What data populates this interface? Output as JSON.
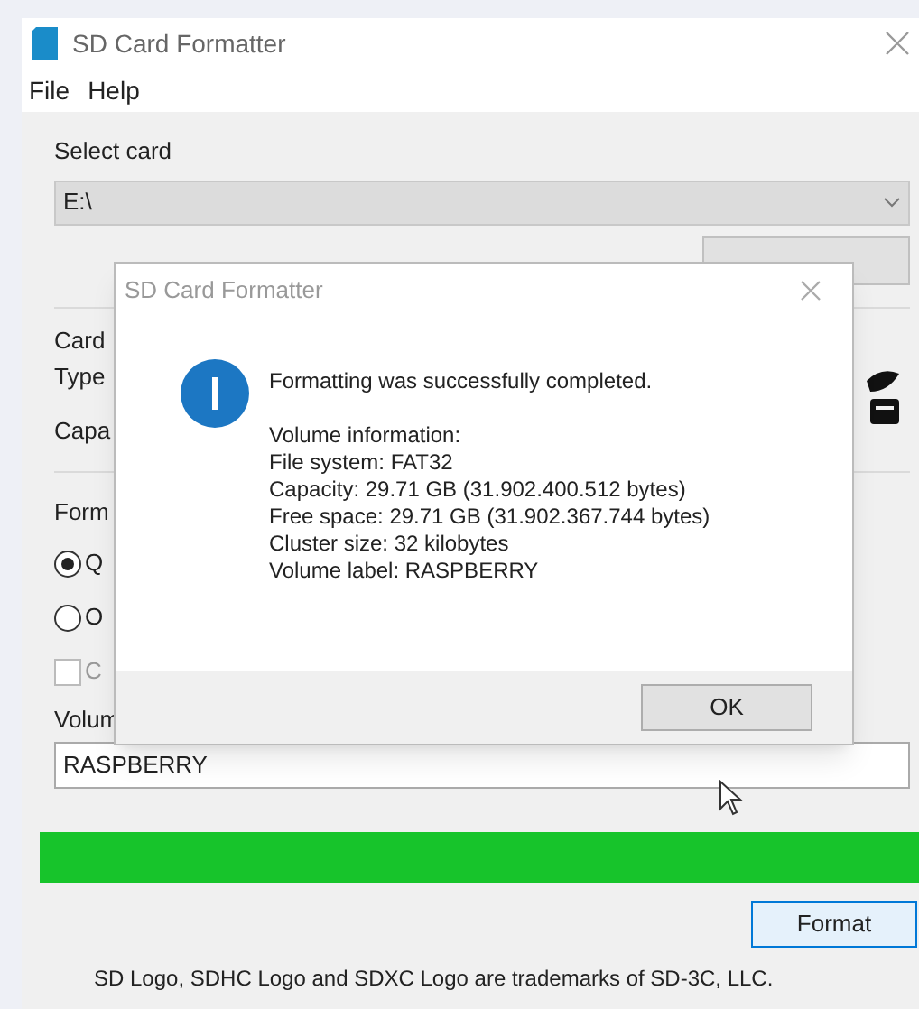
{
  "window": {
    "title": "SD Card Formatter"
  },
  "menu": [
    "File",
    "Help"
  ],
  "select_card": {
    "label": "Select card",
    "value": "E:\\"
  },
  "card_info": [
    "Card",
    "Type",
    "Capa"
  ],
  "format_options": {
    "label": "Form",
    "options": [
      {
        "label": "Q",
        "selected": true
      },
      {
        "label": "O",
        "selected": false
      }
    ],
    "checkbox": {
      "label": "C",
      "checked": false
    }
  },
  "volume_label": {
    "label": "Volum",
    "value": "RASPBERRY"
  },
  "progress": {
    "level": 1
  },
  "format_button": "Format",
  "footer": "SD Logo, SDHC Logo and SDXC Logo are trademarks of SD-3C, LLC.",
  "dialog": {
    "title": "SD Card Formatter",
    "message": "Formatting was successfully completed.",
    "details": [
      "Volume information:",
      "File system: FAT32",
      "Capacity: 29.71 GB (31.902.400.512 bytes)",
      "Free space: 29.71 GB (31.902.367.744 bytes)",
      "Cluster size: 32 kilobytes",
      "Volume label: RASPBERRY"
    ],
    "button": "OK"
  }
}
